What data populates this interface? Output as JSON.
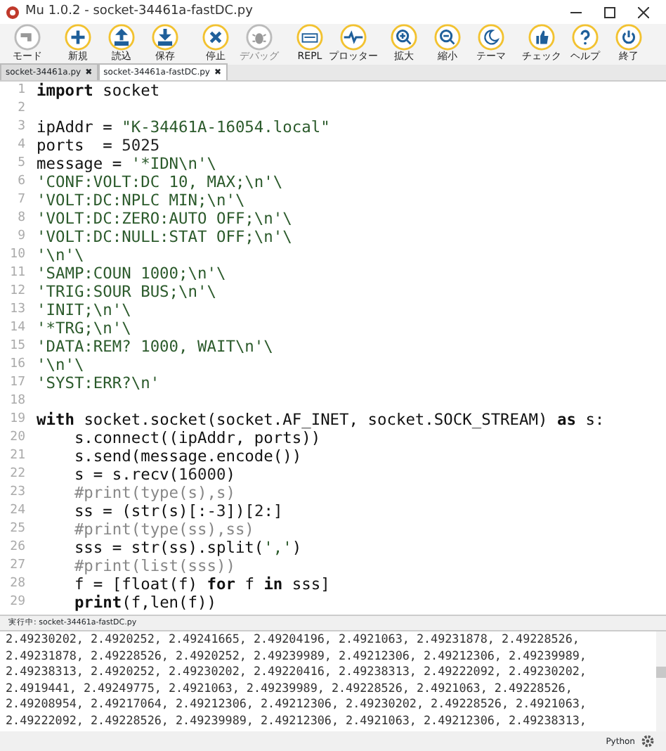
{
  "window": {
    "title": "Mu 1.0.2 - socket-34461a-fastDC.py"
  },
  "toolbar": [
    {
      "label": "モード",
      "disabled": false
    },
    {
      "label": "新規",
      "disabled": false
    },
    {
      "label": "読込",
      "disabled": false
    },
    {
      "label": "保存",
      "disabled": false
    },
    {
      "label": "停止",
      "disabled": false
    },
    {
      "label": "デバッグ",
      "disabled": true
    },
    {
      "label": "REPL",
      "disabled": false
    },
    {
      "label": "プロッター",
      "disabled": false
    },
    {
      "label": "拡大",
      "disabled": false
    },
    {
      "label": "縮小",
      "disabled": false
    },
    {
      "label": "テーマ",
      "disabled": false
    },
    {
      "label": "チェック",
      "disabled": false
    },
    {
      "label": "ヘルプ",
      "disabled": false
    },
    {
      "label": "終了",
      "disabled": false
    }
  ],
  "tabs": [
    {
      "label": "socket-34461a.py",
      "close": "✖",
      "selected": false
    },
    {
      "label": "socket-34461a-fastDC.py",
      "close": "✖",
      "selected": true
    }
  ],
  "editor": {
    "lines": [
      {
        "number": "1",
        "tokens": [
          {
            "kind": "kw",
            "text": "import"
          },
          {
            "kind": "plain",
            "text": " socket"
          }
        ]
      },
      {
        "number": "2"
      },
      {
        "number": "3",
        "tokens": [
          {
            "kind": "plain",
            "text": "ipAddr = "
          },
          {
            "kind": "str",
            "text": "\"K-34461A-16054.local\""
          }
        ]
      },
      {
        "number": "4",
        "tokens": [
          {
            "kind": "plain",
            "text": "ports  = "
          },
          {
            "kind": "num",
            "text": "5025"
          }
        ]
      },
      {
        "number": "5",
        "tokens": [
          {
            "kind": "plain",
            "text": "message = "
          },
          {
            "kind": "str",
            "text": "'*IDN\\n'\\"
          }
        ]
      },
      {
        "number": "6",
        "tokens": [
          {
            "kind": "str",
            "text": "'CONF:VOLT:DC 10, MAX;\\n'\\"
          }
        ]
      },
      {
        "number": "7",
        "tokens": [
          {
            "kind": "str",
            "text": "'VOLT:DC:NPLC MIN;\\n'\\"
          }
        ]
      },
      {
        "number": "8",
        "tokens": [
          {
            "kind": "str",
            "text": "'VOLT:DC:ZERO:AUTO OFF;\\n'\\"
          }
        ]
      },
      {
        "number": "9",
        "tokens": [
          {
            "kind": "str",
            "text": "'VOLT:DC:NULL:STAT OFF;\\n'\\"
          }
        ]
      },
      {
        "number": "10",
        "tokens": [
          {
            "kind": "str",
            "text": "'\\n'\\"
          }
        ]
      },
      {
        "number": "11",
        "tokens": [
          {
            "kind": "str",
            "text": "'SAMP:COUN 1000;\\n'\\"
          }
        ]
      },
      {
        "number": "12",
        "tokens": [
          {
            "kind": "str",
            "text": "'TRIG:SOUR BUS;\\n'\\"
          }
        ]
      },
      {
        "number": "13",
        "tokens": [
          {
            "kind": "str",
            "text": "'INIT;\\n'\\"
          }
        ]
      },
      {
        "number": "14",
        "tokens": [
          {
            "kind": "str",
            "text": "'*TRG;\\n'\\"
          }
        ]
      },
      {
        "number": "15",
        "tokens": [
          {
            "kind": "str",
            "text": "'DATA:REM? 1000, WAIT\\n'\\"
          }
        ]
      },
      {
        "number": "16",
        "tokens": [
          {
            "kind": "str",
            "text": "'\\n'\\"
          }
        ]
      },
      {
        "number": "17",
        "tokens": [
          {
            "kind": "str",
            "text": "'SYST:ERR?\\n'"
          }
        ]
      },
      {
        "number": "18"
      },
      {
        "number": "19",
        "tokens": [
          {
            "kind": "kw",
            "text": "with"
          },
          {
            "kind": "plain",
            "text": " socket.socket(socket.AF_INET, socket.SOCK_STREAM) "
          },
          {
            "kind": "kw",
            "text": "as"
          },
          {
            "kind": "plain",
            "text": " s:"
          }
        ]
      },
      {
        "number": "20",
        "tokens": [
          {
            "kind": "plain",
            "text": "    s.connect((ipAddr, ports))"
          }
        ]
      },
      {
        "number": "21",
        "tokens": [
          {
            "kind": "plain",
            "text": "    s.send(message.encode())"
          }
        ]
      },
      {
        "number": "22",
        "tokens": [
          {
            "kind": "plain",
            "text": "    s = s.recv("
          },
          {
            "kind": "num",
            "text": "16000"
          },
          {
            "kind": "plain",
            "text": ")"
          }
        ]
      },
      {
        "number": "23",
        "tokens": [
          {
            "kind": "com",
            "text": "    #print(type(s),s)"
          }
        ]
      },
      {
        "number": "24",
        "tokens": [
          {
            "kind": "plain",
            "text": "    ss = (str(s)[:"
          },
          {
            "kind": "num",
            "text": "-3"
          },
          {
            "kind": "plain",
            "text": "])["
          },
          {
            "kind": "num",
            "text": "2"
          },
          {
            "kind": "plain",
            "text": ":]"
          }
        ]
      },
      {
        "number": "25",
        "tokens": [
          {
            "kind": "com",
            "text": "    #print(type(ss),ss)"
          }
        ]
      },
      {
        "number": "26",
        "tokens": [
          {
            "kind": "plain",
            "text": "    sss = str(ss).split("
          },
          {
            "kind": "str",
            "text": "','"
          },
          {
            "kind": "plain",
            "text": ")"
          }
        ]
      },
      {
        "number": "27",
        "tokens": [
          {
            "kind": "com",
            "text": "    #print(list(sss))"
          }
        ]
      },
      {
        "number": "28",
        "tokens": [
          {
            "kind": "plain",
            "text": "    f = [float(f) "
          },
          {
            "kind": "kw",
            "text": "for"
          },
          {
            "kind": "plain",
            "text": " f "
          },
          {
            "kind": "kw",
            "text": "in"
          },
          {
            "kind": "plain",
            "text": " sss]"
          }
        ]
      },
      {
        "number": "29",
        "tokens": [
          {
            "kind": "kw",
            "text": "    print"
          },
          {
            "kind": "plain",
            "text": "(f,len(f))"
          }
        ]
      }
    ]
  },
  "output": {
    "title": "実行中: socket-34461a-fastDC.py",
    "lines": [
      "2.49230202, 2.4920252, 2.49241665, 2.49204196, 2.4921063, 2.49231878, 2.49228526,",
      "2.49231878, 2.49228526, 2.4920252, 2.49239989, 2.49212306, 2.49212306, 2.49239989,",
      "2.49238313, 2.4920252, 2.49230202, 2.49220416, 2.49238313, 2.49222092, 2.49230202,",
      "2.4919441, 2.49249775, 2.4921063, 2.49239989, 2.49228526, 2.4921063, 2.49228526,",
      "2.49208954, 2.49217064, 2.49212306, 2.49212306, 2.49230202, 2.49228526, 2.4921063,",
      "2.49222092, 2.49228526, 2.49239989, 2.49212306, 2.4921063, 2.49212306, 2.49238313,"
    ]
  },
  "status_bar": {
    "mode": "Python"
  }
}
